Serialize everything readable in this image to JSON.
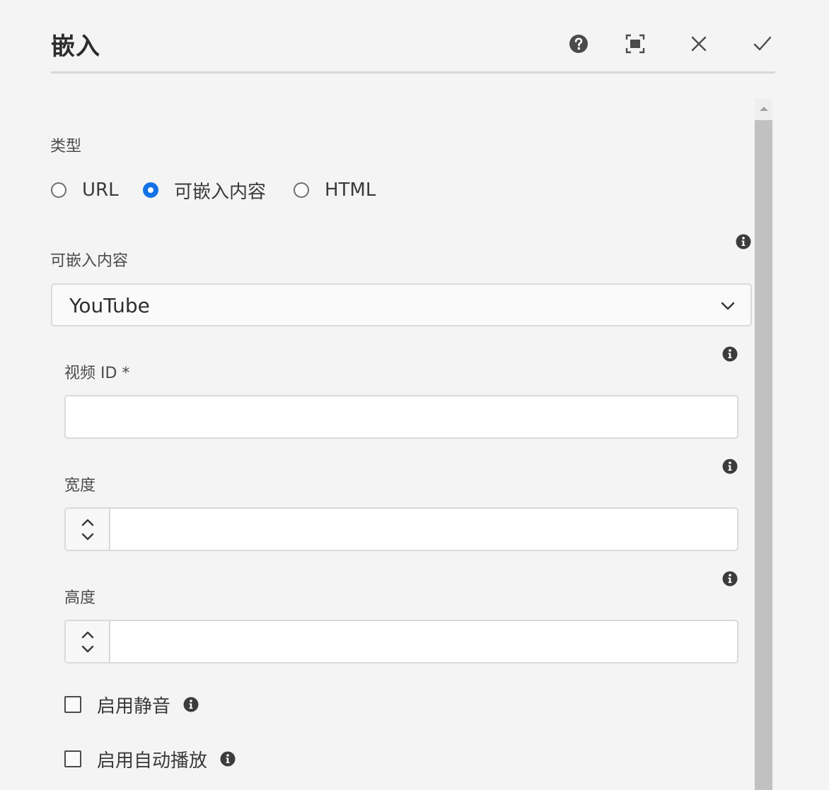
{
  "dialog": {
    "title": "嵌入",
    "actions": {
      "help": "help-icon",
      "fullscreen": "fullscreen-icon",
      "close": "close-icon",
      "done": "check-icon"
    }
  },
  "type_section": {
    "label": "类型",
    "options": [
      {
        "label": "URL",
        "selected": false
      },
      {
        "label": "可嵌入内容",
        "selected": true
      },
      {
        "label": "HTML",
        "selected": false
      }
    ]
  },
  "embeddable": {
    "label": "可嵌入内容",
    "selected_value": "YouTube"
  },
  "video_id": {
    "label": "视频 ID *",
    "value": "",
    "placeholder": ""
  },
  "width": {
    "label": "宽度",
    "value": ""
  },
  "height": {
    "label": "高度",
    "value": ""
  },
  "checkboxes": [
    {
      "label": "启用静音",
      "checked": false
    },
    {
      "label": "启用自动播放",
      "checked": false
    }
  ],
  "colors": {
    "accent": "#1473e6",
    "background": "#f4f4f4",
    "border": "#dadada",
    "scrollbar_thumb": "#c1c1c1"
  }
}
